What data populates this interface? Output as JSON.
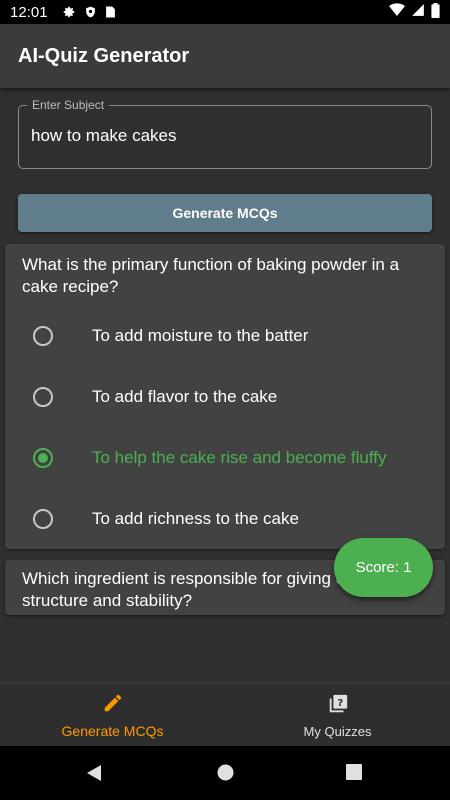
{
  "status_bar": {
    "time": "12:01",
    "icons": [
      "gear-icon",
      "shield-icon",
      "sim-card-icon"
    ],
    "right_icons": [
      "wifi-icon",
      "signal-icon",
      "battery-icon"
    ]
  },
  "app_bar": {
    "title": "AI-Quiz Generator"
  },
  "subject_field": {
    "label": "Enter Subject",
    "value": "how to make cakes"
  },
  "generate_button": {
    "label": "Generate MCQs"
  },
  "questions": [
    {
      "text": "What is the primary function of baking powder in a cake recipe?",
      "options": [
        {
          "text": "To add moisture to the batter",
          "selected": false
        },
        {
          "text": "To add flavor to the cake",
          "selected": false
        },
        {
          "text": "To help the cake rise and become fluffy",
          "selected": true
        },
        {
          "text": "To add richness to the cake",
          "selected": false
        }
      ]
    },
    {
      "text": "Which ingredient is responsible for giving cakes structure and stability?"
    }
  ],
  "score": {
    "label": "Score: 1"
  },
  "bottom_nav": [
    {
      "label": "Generate MCQs",
      "icon": "pencil-icon",
      "active": true
    },
    {
      "label": "My Quizzes",
      "icon": "quiz-icon",
      "active": false
    }
  ],
  "colors": {
    "accent_green": "#4caf50",
    "accent_orange": "#ff9800",
    "button": "#607d8b"
  }
}
